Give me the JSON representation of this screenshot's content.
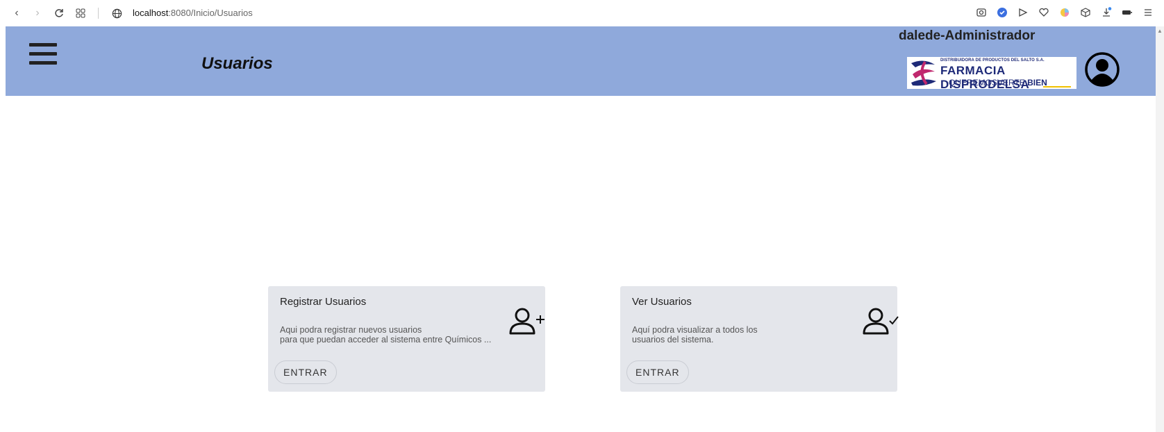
{
  "browser": {
    "url_host": "localhost",
    "url_port_path": ":8080/Inicio/Usuarios"
  },
  "header": {
    "title": "Usuarios",
    "user_label": "dalede-Administrador",
    "logo": {
      "line1": "DISTRIBUIDORA DE PRODUCTOS DEL SALTO S.A.",
      "line2": "FARMACIA DISPRODELSA",
      "line3_a": "QUEREMOSVERTE ",
      "line3_b": "BIEN"
    },
    "bg_color": "#8fa9db"
  },
  "cards": [
    {
      "title": "Registrar Usuarios",
      "desc_line1": "Aqui podra registrar nuevos usuarios",
      "desc_line2": "para que puedan acceder al sistema entre Químicos ...",
      "button": "ENTRAR",
      "icon": "user-plus-icon"
    },
    {
      "title": "Ver Usuarios",
      "desc_line1": "Aquí podra visualizar a todos los",
      "desc_line2": "usuarios del sistema.",
      "button": "ENTRAR",
      "icon": "user-check-icon"
    }
  ]
}
